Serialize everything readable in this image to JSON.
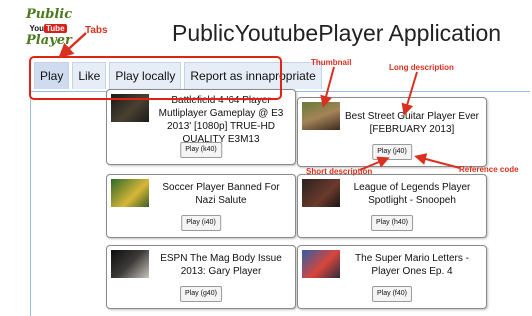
{
  "logo": {
    "line1": "Public",
    "brand_prefix": "You",
    "brand_suffix": "Tube",
    "line2": "Player"
  },
  "app": {
    "title": "PublicYoutubePlayer Application"
  },
  "tabs": [
    {
      "label": "Play",
      "active": true
    },
    {
      "label": "Like",
      "active": false
    },
    {
      "label": "Play locally",
      "active": false
    },
    {
      "label": "Report as innapropriate",
      "active": false
    }
  ],
  "annotations": {
    "tabs": "Tabs",
    "thumbnail": "Thumbnail",
    "long_description": "Long description",
    "short_description": "Short description",
    "reference_code": "Reference code"
  },
  "videos": [
    {
      "long_description": "Battlefield 4 '64 Player Mutliplayer Gameplay @ E3 2013' [1080p] TRUE-HD QUALITY E3M13",
      "short_description": "Play (k40)"
    },
    {
      "long_description": "Best Street Guitar Player Ever [FEBRUARY 2013]",
      "short_description": "Play (j40)"
    },
    {
      "long_description": "Soccer Player Banned For Nazi Salute",
      "short_description": "Play (i40)"
    },
    {
      "long_description": "League of Legends Player Spotlight - Snoopeh",
      "short_description": "Play (h40)"
    },
    {
      "long_description": "ESPN The Mag Body Issue 2013: Gary Player",
      "short_description": "Play (g40)"
    },
    {
      "long_description": "The Super Mario Letters - Player Ones Ep. 4",
      "short_description": "Play (f40)"
    }
  ],
  "colors": {
    "annotation": "#d9301f",
    "tab_border": "#9dbbe0",
    "logo_green": "#4a7a1c"
  }
}
